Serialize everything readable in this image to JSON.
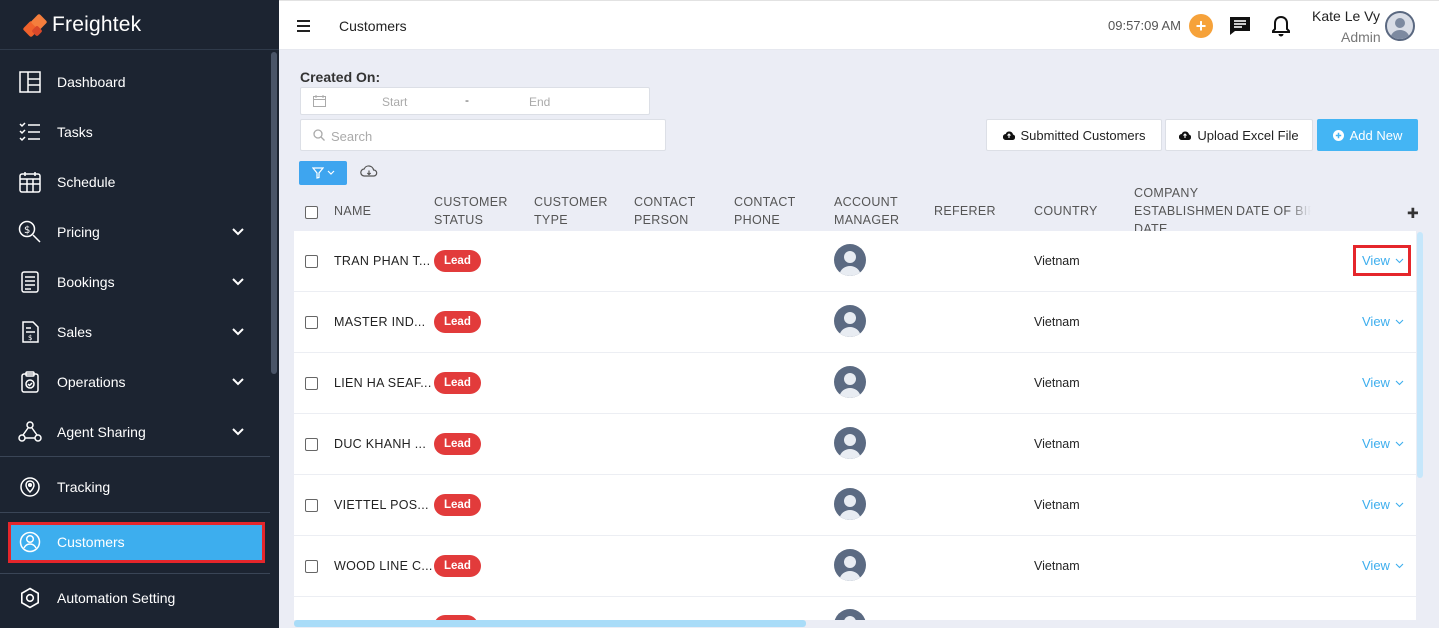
{
  "app": {
    "name": "Freightek"
  },
  "sidebar": {
    "items": [
      {
        "label": "Dashboard",
        "icon": "dashboard-icon",
        "expandable": false
      },
      {
        "label": "Tasks",
        "icon": "tasks-icon",
        "expandable": false
      },
      {
        "label": "Schedule",
        "icon": "calendar-icon",
        "expandable": false
      },
      {
        "label": "Pricing",
        "icon": "pricing-icon",
        "expandable": true
      },
      {
        "label": "Bookings",
        "icon": "bookings-icon",
        "expandable": true
      },
      {
        "label": "Sales",
        "icon": "sales-icon",
        "expandable": true
      },
      {
        "label": "Operations",
        "icon": "operations-icon",
        "expandable": true
      },
      {
        "label": "Agent Sharing",
        "icon": "agent-sharing-icon",
        "expandable": true
      },
      {
        "label": "Tracking",
        "icon": "tracking-icon",
        "expandable": false
      },
      {
        "label": "Customers",
        "icon": "customers-icon",
        "expandable": false,
        "active": true
      },
      {
        "label": "Automation Setting",
        "icon": "automation-icon",
        "expandable": false
      }
    ]
  },
  "header": {
    "title": "Customers",
    "time": "09:57:09 AM",
    "user_name": "Kate Le Vy",
    "user_role": "Admin"
  },
  "filters": {
    "created_on_label": "Created On:",
    "start_placeholder": "Start",
    "separator": "-",
    "end_placeholder": "End",
    "search_placeholder": "Search"
  },
  "actions": {
    "submitted_customers": "Submitted Customers",
    "upload_excel": "Upload Excel File",
    "add_new": "Add New"
  },
  "table": {
    "columns": [
      "NAME",
      "CUSTOMER STATUS",
      "CUSTOMER TYPE",
      "CONTACT PERSON",
      "CONTACT PHONE",
      "ACCOUNT MANAGER",
      "REFERER",
      "COUNTRY",
      "COMPANY ESTABLISHMENT DATE",
      "DATE OF BIRTH"
    ],
    "rows": [
      {
        "name": "TRAN PHAN T...",
        "status": "Lead",
        "country": "Vietnam",
        "action": "View"
      },
      {
        "name": "MASTER IND...",
        "status": "Lead",
        "country": "Vietnam",
        "action": "View"
      },
      {
        "name": "LIEN HA SEAF...",
        "status": "Lead",
        "country": "Vietnam",
        "action": "View"
      },
      {
        "name": "DUC KHANH ...",
        "status": "Lead",
        "country": "Vietnam",
        "action": "View"
      },
      {
        "name": "VIETTEL POS...",
        "status": "Lead",
        "country": "Vietnam",
        "action": "View"
      },
      {
        "name": "WOOD LINE C...",
        "status": "Lead",
        "country": "Vietnam",
        "action": "View"
      }
    ]
  },
  "colors": {
    "sidebar_bg": "#1c2431",
    "accent": "#3daeee",
    "lead_badge": "#e23b3b",
    "highlight": "#e5262b",
    "logo": "#f0622c"
  }
}
